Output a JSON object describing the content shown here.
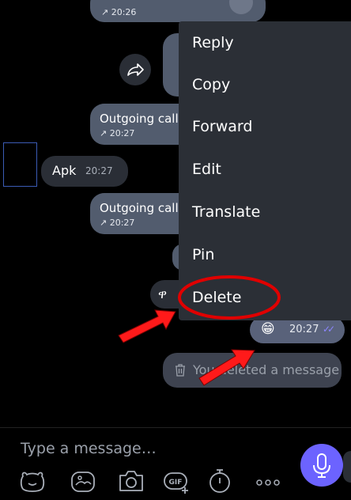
{
  "messages": {
    "top_call_time": "↗ 20:26",
    "outgoing_call_1": {
      "title": "Outgoing call",
      "time": "↗ 20:27"
    },
    "apk": {
      "text": "Apk",
      "time": "20:27"
    },
    "outgoing_call_2": {
      "title": "Outgoing call",
      "time": "↗ 20:27"
    },
    "emoji_message": {
      "emoji": "😁",
      "time": "20:27",
      "status": "✓✓"
    },
    "deleted_notice": "You deleted a message"
  },
  "context_menu": {
    "items": [
      "Reply",
      "Copy",
      "Forward",
      "Edit",
      "Translate",
      "Pin",
      "Delete"
    ],
    "highlighted": "Delete"
  },
  "composer": {
    "placeholder": "Type a message…",
    "icons": [
      "sticker-icon",
      "gallery-icon",
      "camera-icon",
      "gif-icon",
      "timer-icon",
      "more-icon",
      "microphone-icon"
    ]
  },
  "colors": {
    "bubble": "#525c6e",
    "menu_bg": "#2b2f36",
    "accent": "#6c63ff",
    "highlight": "#e00000"
  }
}
